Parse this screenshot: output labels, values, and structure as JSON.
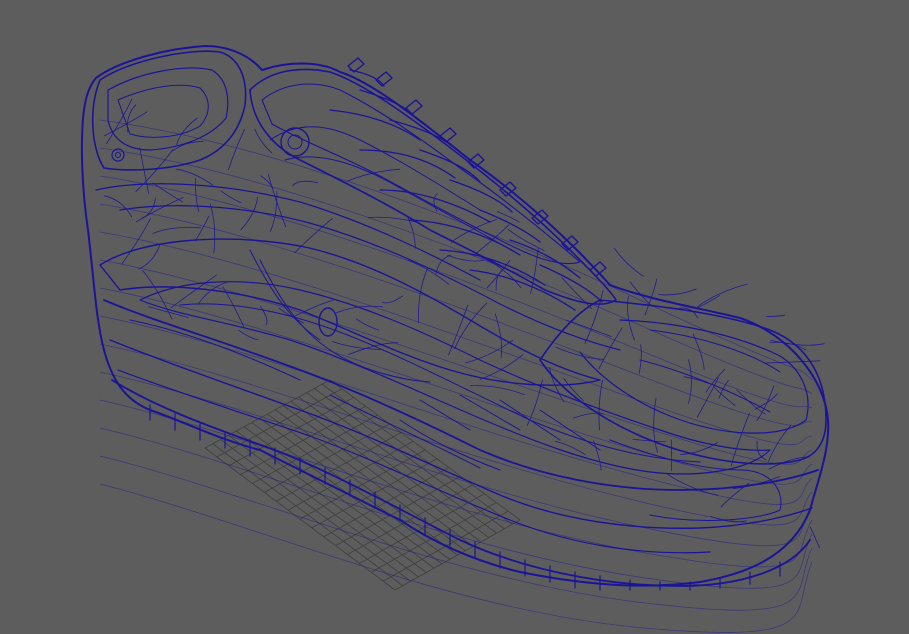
{
  "viewport": {
    "view": "perspective",
    "display_mode": "wireframe",
    "background_color": "#5d5d5d",
    "grid_color": "#3f3f3f",
    "wire_color": "#1c1496",
    "model": "sneaker"
  }
}
